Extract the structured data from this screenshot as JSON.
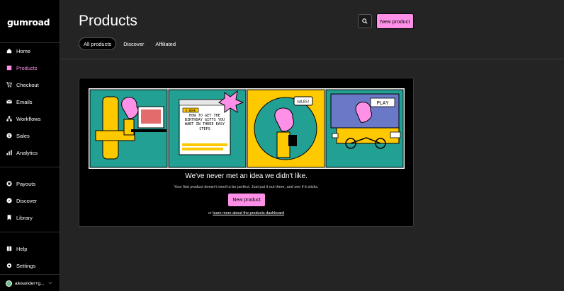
{
  "app": {
    "logo": "GUMROAD"
  },
  "sidebar": {
    "items": [
      {
        "label": "Home",
        "icon": "home-icon"
      },
      {
        "label": "Products",
        "icon": "products-icon",
        "active": true
      },
      {
        "label": "Checkout",
        "icon": "cart-icon"
      },
      {
        "label": "Emails",
        "icon": "envelope-icon"
      },
      {
        "label": "Workflows",
        "icon": "workflow-icon"
      },
      {
        "label": "Sales",
        "icon": "dollar-icon"
      },
      {
        "label": "Analytics",
        "icon": "bar-chart-icon"
      },
      {
        "label": "Payouts",
        "icon": "bank-icon"
      },
      {
        "label": "Discover",
        "icon": "search-icon"
      },
      {
        "label": "Library",
        "icon": "bookmark-icon"
      },
      {
        "label": "Help",
        "icon": "book-icon"
      },
      {
        "label": "Settings",
        "icon": "gear-icon"
      }
    ],
    "user": "alexander+g..."
  },
  "header": {
    "title": "Products",
    "new_product_label": "New product",
    "tabs": [
      "All products",
      "Discover",
      "Affiliated"
    ]
  },
  "empty_state": {
    "comic_text": {
      "ebook_tag": "E-BOOK",
      "ebook_title": "HOW TO GET THE BIRTHDAY GIFTS YOU WANT IN THREE EASY STEPS",
      "sales_bubble": "SALES!",
      "play_sign": "PLAY"
    },
    "title": "We've never met an idea we didn't like.",
    "subtitle": "Your first product doesn't need to be perfect. Just put it out there, and see if it sticks.",
    "button_label": "New product",
    "learn_prefix": "or ",
    "learn_link": "learn more about the products dashboard"
  },
  "colors": {
    "accent": "#ff90e8",
    "teal": "#23a094",
    "yellow": "#ffc900"
  }
}
